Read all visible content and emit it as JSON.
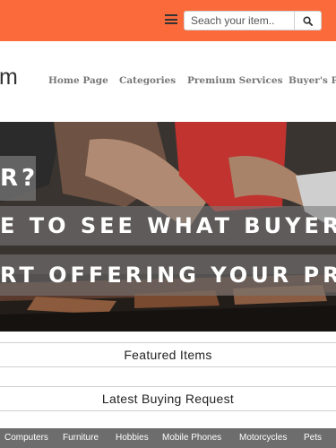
{
  "header": {
    "search_placeholder": "Seach your item..",
    "menu_icon": "hamburger-menu-icon",
    "search_icon": "magnifier-icon",
    "accent_color": "#fb6a3a"
  },
  "nav": {
    "logo_fragment": "m",
    "items": [
      "Home Page",
      "Categories",
      "Premium Services",
      "Buyer's Pa"
    ]
  },
  "hero": {
    "line1": "R?",
    "line2": "E TO SEE WHAT BUYERS ARE L",
    "line3": "RT OFFERING YOUR PRODUCTS"
  },
  "sections": {
    "featured": "Featured Items",
    "buying": "Latest Buying Request"
  },
  "categories": [
    "Computers",
    "Furniture",
    "Hobbies",
    "Mobile Phones",
    "Motorcycles",
    "Pets"
  ]
}
